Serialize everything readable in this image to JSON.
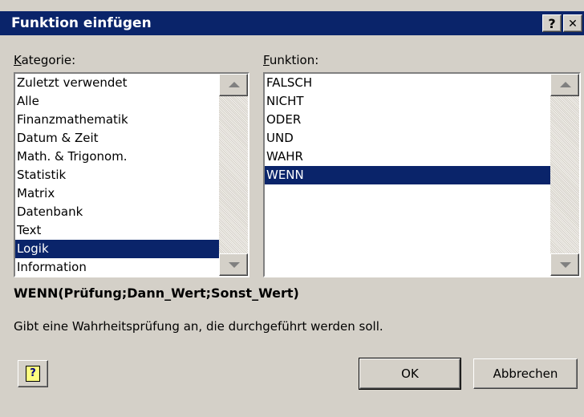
{
  "window": {
    "title": "Funktion einfügen",
    "help_glyph": "?",
    "close_glyph": "✕"
  },
  "kategorie": {
    "label_accel": "K",
    "label_rest": "ategorie:",
    "items": [
      {
        "label": "Zuletzt verwendet",
        "selected": false
      },
      {
        "label": "Alle",
        "selected": false
      },
      {
        "label": "Finanzmathematik",
        "selected": false
      },
      {
        "label": "Datum & Zeit",
        "selected": false
      },
      {
        "label": "Math. & Trigonom.",
        "selected": false
      },
      {
        "label": "Statistik",
        "selected": false
      },
      {
        "label": "Matrix",
        "selected": false
      },
      {
        "label": "Datenbank",
        "selected": false
      },
      {
        "label": "Text",
        "selected": false
      },
      {
        "label": "Logik",
        "selected": true
      },
      {
        "label": "Information",
        "selected": false
      }
    ]
  },
  "funktion": {
    "label_accel": "F",
    "label_rest": "unktion:",
    "items": [
      {
        "label": "FALSCH",
        "selected": false
      },
      {
        "label": "NICHT",
        "selected": false
      },
      {
        "label": "ODER",
        "selected": false
      },
      {
        "label": "UND",
        "selected": false
      },
      {
        "label": "WAHR",
        "selected": false
      },
      {
        "label": "WENN",
        "selected": true
      }
    ]
  },
  "signature": "WENN(Prüfung;Dann_Wert;Sonst_Wert)",
  "description": "Gibt eine Wahrheitsprüfung an, die durchgeführt werden soll.",
  "buttons": {
    "help_icon_glyph": "?",
    "ok": "OK",
    "cancel": "Abbrechen"
  },
  "colors": {
    "titlebar": "#0a246a",
    "selection": "#0a246a",
    "face": "#d4d0c8"
  }
}
